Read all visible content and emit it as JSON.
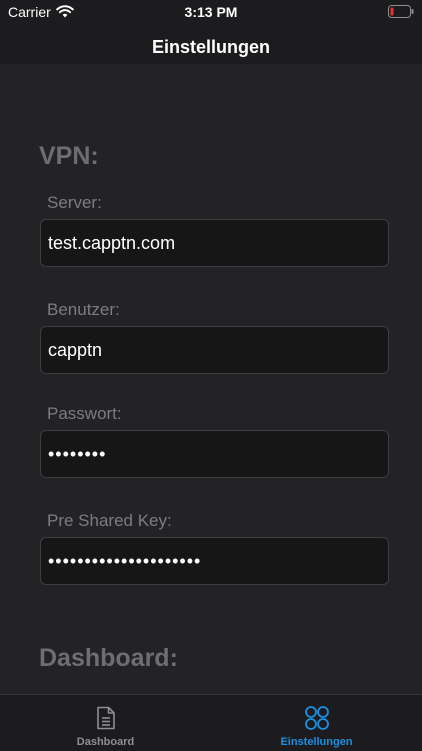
{
  "status_bar": {
    "carrier": "Carrier",
    "time": "3:13 PM",
    "wifi_icon": "wifi-icon",
    "battery_icon": "battery-low-icon",
    "battery_color": "#e0342c"
  },
  "nav": {
    "title": "Einstellungen"
  },
  "vpn": {
    "heading": "VPN:",
    "server": {
      "label": "Server:",
      "value": "test.capptn.com"
    },
    "user": {
      "label": "Benutzer:",
      "value": "capptn"
    },
    "password": {
      "label": "Passwort:",
      "value": "••••••••"
    },
    "psk": {
      "label": "Pre Shared Key:",
      "value": "•••••••••••••••••••••"
    }
  },
  "dashboard_section": {
    "heading": "Dashboard:"
  },
  "tab_bar": {
    "tabs": [
      {
        "label": "Dashboard",
        "icon": "document-icon",
        "active": false
      },
      {
        "label": "Einstellungen",
        "icon": "four-circles-icon",
        "active": true
      }
    ],
    "active_color": "#1a8fe3",
    "inactive_color": "#8e8e93"
  }
}
